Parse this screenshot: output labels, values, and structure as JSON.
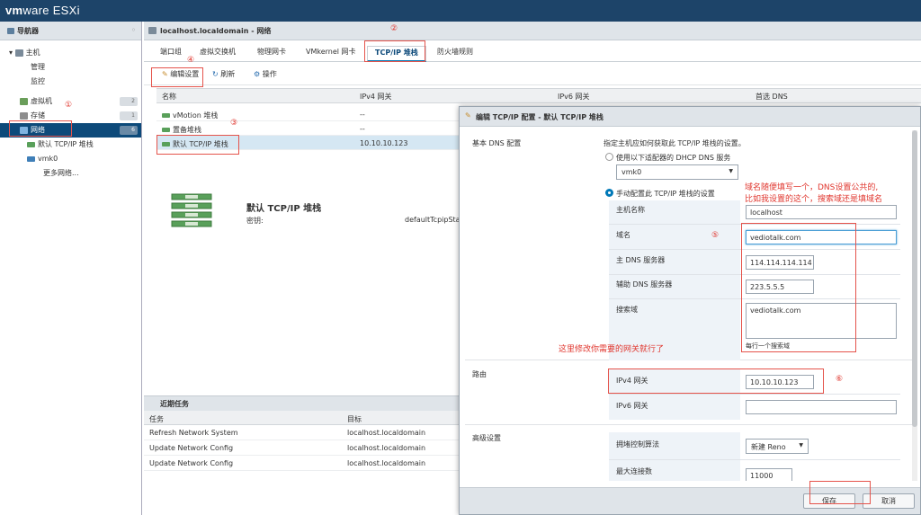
{
  "app": {
    "brand_a": "vm",
    "brand_b": "ware",
    "brand_c": "ESXi"
  },
  "navigator": {
    "title": "导航器",
    "items": [
      {
        "label": "主机",
        "badge": ""
      },
      {
        "label": "管理",
        "badge": ""
      },
      {
        "label": "监控",
        "badge": ""
      },
      {
        "label": "虚拟机",
        "badge": "2"
      },
      {
        "label": "存储",
        "badge": "1"
      },
      {
        "label": "网络",
        "badge": "6"
      },
      {
        "label": "默认 TCP/IP 堆栈",
        "badge": ""
      },
      {
        "label": "vmk0",
        "badge": ""
      },
      {
        "label": "更多网络...",
        "badge": ""
      }
    ]
  },
  "main": {
    "title": "localhost.localdomain - 网络",
    "tabs": [
      "端口组",
      "虚拟交换机",
      "物理网卡",
      "VMkernel 网卡",
      "TCP/IP 堆栈",
      "防火墙规则"
    ],
    "toolbar": {
      "edit": "编辑设置",
      "refresh": "刷新",
      "actions": "操作"
    },
    "columns": [
      "名称",
      "IPv4 网关",
      "IPv6 网关",
      "首选 DNS"
    ],
    "rows": [
      {
        "name": "vMotion 堆栈",
        "ipv4": "--",
        "ipv6": ""
      },
      {
        "name": "置备堆栈",
        "ipv4": "--",
        "ipv6": ""
      },
      {
        "name": "默认 TCP/IP 堆栈",
        "ipv4": "10.10.10.123",
        "ipv6": ""
      }
    ],
    "detail": {
      "title": "默认 TCP/IP 堆栈",
      "key_label": "密钥:",
      "key_value": "defaultTcpipStac"
    }
  },
  "recent": {
    "title": "近期任务",
    "columns": [
      "任务",
      "目标"
    ],
    "rows": [
      {
        "task": "Refresh Network System",
        "target": "localhost.localdomain"
      },
      {
        "task": "Update Network Config",
        "target": "localhost.localdomain"
      },
      {
        "task": "Update Network Config",
        "target": "localhost.localdomain"
      }
    ]
  },
  "dialog": {
    "title": "编辑 TCP/IP 配置 - 默认 TCP/IP 堆栈",
    "dns_section": "基本 DNS 配置",
    "dns_desc": "指定主机应如何获取此 TCP/IP 堆栈的设置。",
    "dhcp_option": "使用以下适配器的 DHCP DNS 服务",
    "adapter": "vmk0",
    "manual_option": "手动配置此 TCP/IP 堆栈的设置",
    "host_label": "主机名称",
    "host_value": "localhost",
    "domain_label": "域名",
    "domain_value": "vediotalk.com",
    "dns1_label": "主 DNS 服务器",
    "dns1_value": "114.114.114.114",
    "dns2_label": "辅助 DNS 服务器",
    "dns2_value": "223.5.5.5",
    "search_label": "搜索域",
    "search_value": "vediotalk.com",
    "search_hint": "每行一个搜索域",
    "route_section": "路由",
    "ipv4_label": "IPv4 网关",
    "ipv4_value": "10.10.10.123",
    "ipv6_label": "IPv6 网关",
    "ipv6_value": "",
    "adv_section": "高级设置",
    "cc_label": "拥堵控制算法",
    "cc_value": "新建 Reno",
    "maxconn_label": "最大连接数",
    "maxconn_value": "11000",
    "save": "保存",
    "cancel": "取消"
  },
  "annotations": {
    "n1": "①",
    "n2": "②",
    "n3": "③",
    "n4": "④",
    "n5": "⑤",
    "n6": "⑥",
    "note_dns_1": "域名随便填写一个，DNS设置公共的,",
    "note_dns_2": "比如我设置的这个，搜索域还是填域名",
    "note_gw": "这里修改你需要的网关就行了",
    "color": "#e0362e"
  }
}
